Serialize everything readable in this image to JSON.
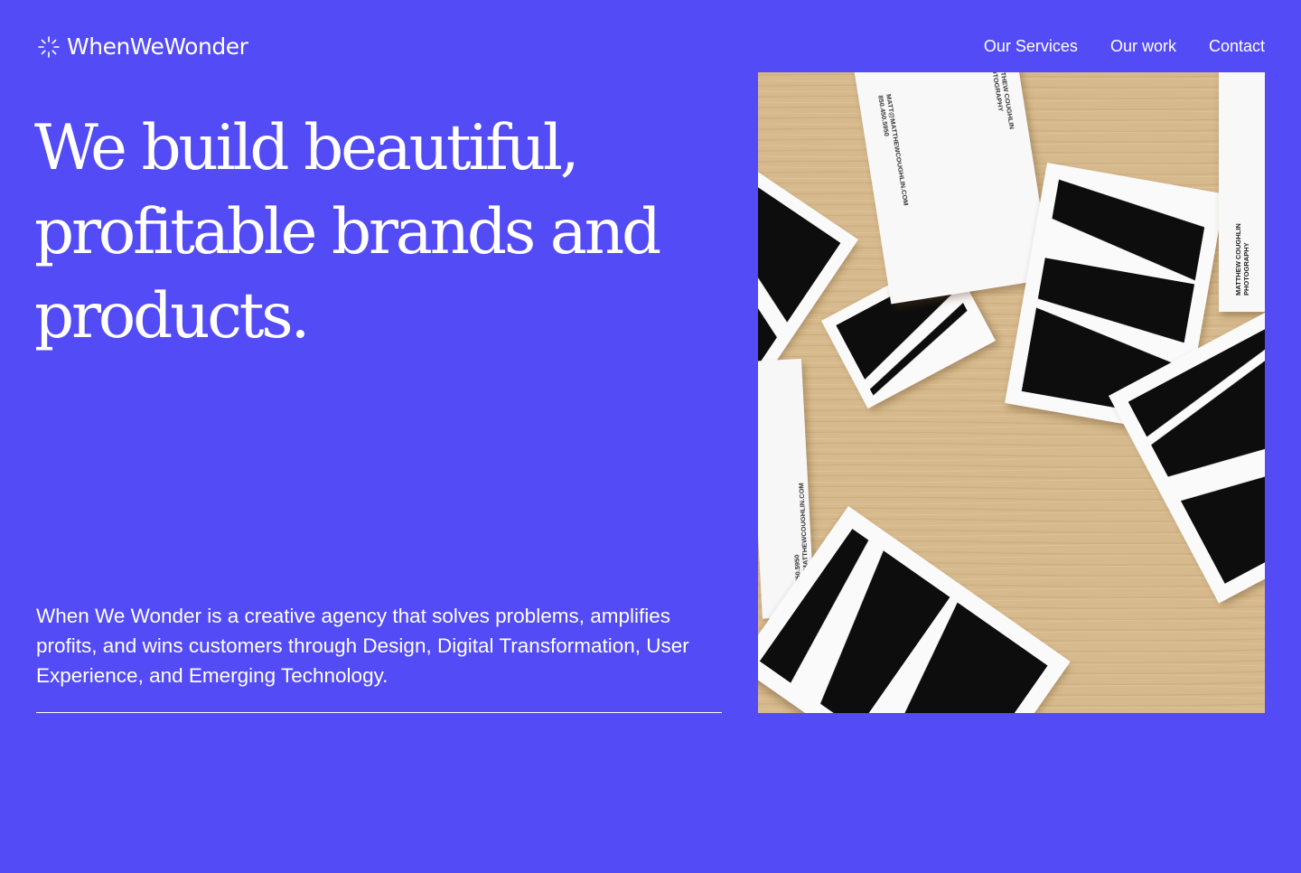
{
  "brand": {
    "name": "WhenWeWonder",
    "logo_icon": "sparkle-burst-icon"
  },
  "nav": {
    "items": [
      {
        "label": "Our Services"
      },
      {
        "label": "Our work"
      },
      {
        "label": "Contact"
      }
    ]
  },
  "hero": {
    "headline_lines": [
      "We build beautiful,",
      "profitable brands and",
      "products."
    ],
    "description": "When We Wonder is a creative agency that solves problems, amplifies profits, and wins customers through Design, Digital Transformation, User Experience, and Emerging Technology."
  },
  "image": {
    "subject": "business-cards-photo",
    "card_text": {
      "name": "MATTHEW COUGHLIN",
      "title": "PHOTOGRAPHY",
      "phone": "850.450.5950",
      "email": "MATT@MATTHEWCOUGHLIN.COM"
    }
  },
  "colors": {
    "background": "#534BF5",
    "text": "#FFFFFF",
    "wood": "#D4B68A"
  }
}
